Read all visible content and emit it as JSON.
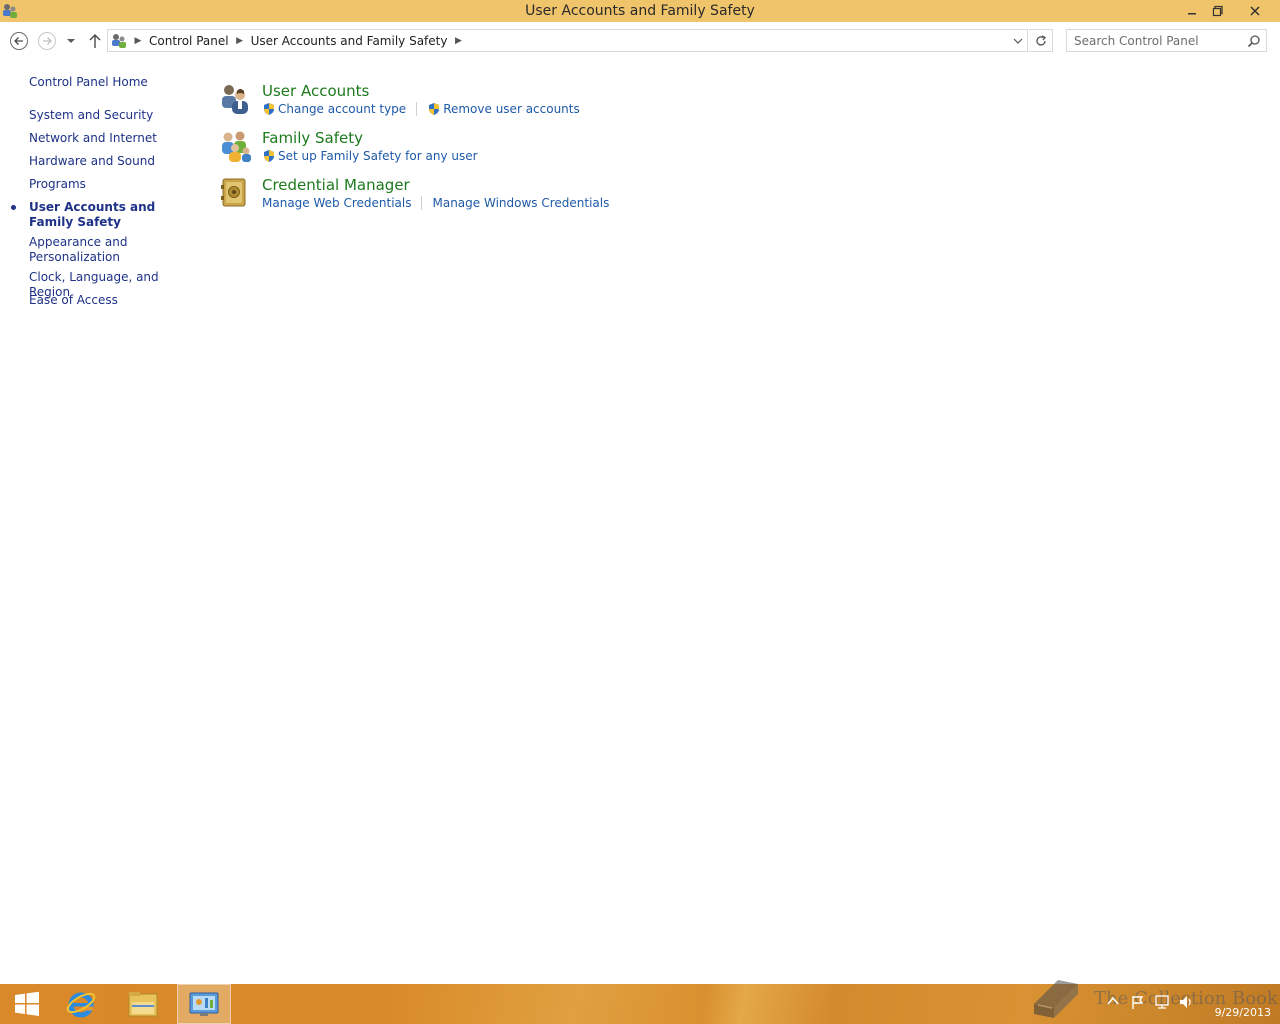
{
  "window": {
    "title": "User Accounts and Family Safety",
    "minimize_label": "minimize",
    "maximize_label": "restore",
    "close_label": "close"
  },
  "address_bar": {
    "breadcrumbs": [
      "Control Panel",
      "User Accounts and Family Safety"
    ]
  },
  "search": {
    "placeholder": "Search Control Panel"
  },
  "sidebar": {
    "items": [
      {
        "label": "Control Panel Home"
      },
      {
        "label": "System and Security"
      },
      {
        "label": "Network and Internet"
      },
      {
        "label": "Hardware and Sound"
      },
      {
        "label": "Programs"
      },
      {
        "label": "User Accounts and Family Safety",
        "current": true
      },
      {
        "label": "Appearance and Personalization"
      },
      {
        "label": "Clock, Language, and Region"
      },
      {
        "label": "Ease of Access"
      }
    ]
  },
  "categories": [
    {
      "title": "User Accounts",
      "icon": "user-accounts-icon",
      "links": [
        {
          "label": "Change account type",
          "shield": true
        },
        {
          "label": "Remove user accounts",
          "shield": true
        }
      ]
    },
    {
      "title": "Family Safety",
      "icon": "family-safety-icon",
      "links": [
        {
          "label": "Set up Family Safety for any user",
          "shield": true
        }
      ]
    },
    {
      "title": "Credential Manager",
      "icon": "credential-manager-icon",
      "links": [
        {
          "label": "Manage Web Credentials",
          "shield": false
        },
        {
          "label": "Manage Windows Credentials",
          "shield": false
        }
      ]
    }
  ],
  "taskbar": {
    "items": [
      "start-button",
      "internet-explorer",
      "file-explorer",
      "control-panel"
    ],
    "clock_date": "9/29/2013",
    "watermark": "The Collection Book"
  },
  "colors": {
    "titlebar": "#f0c46a",
    "sidebar_link": "#1e3287",
    "category_title": "#1e7a1e",
    "task_link": "#1e5aa8"
  }
}
